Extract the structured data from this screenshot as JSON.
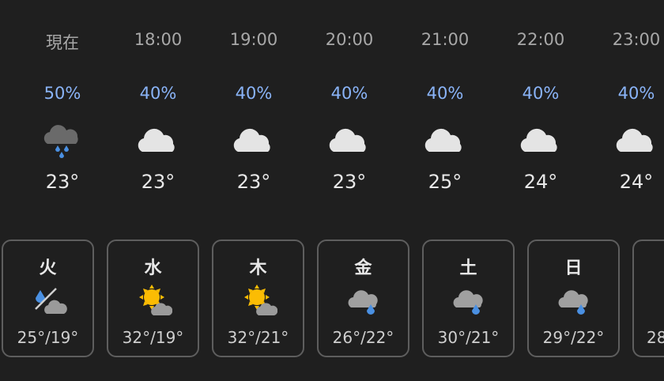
{
  "hourly": [
    {
      "time": "現在",
      "precip": "50%",
      "temp": "23°",
      "icon": "cloud-rain-icon"
    },
    {
      "time": "18:00",
      "precip": "40%",
      "temp": "23°",
      "icon": "cloud-icon"
    },
    {
      "time": "19:00",
      "precip": "40%",
      "temp": "23°",
      "icon": "cloud-icon"
    },
    {
      "time": "20:00",
      "precip": "40%",
      "temp": "23°",
      "icon": "cloud-icon"
    },
    {
      "time": "21:00",
      "precip": "40%",
      "temp": "25°",
      "icon": "cloud-icon"
    },
    {
      "time": "22:00",
      "precip": "40%",
      "temp": "24°",
      "icon": "cloud-icon"
    },
    {
      "time": "23:00",
      "precip": "40%",
      "temp": "24°",
      "icon": "cloud-icon"
    }
  ],
  "daily": [
    {
      "day": "火",
      "temps": "25°/19°",
      "icon": "rain-or-cloudy-icon"
    },
    {
      "day": "水",
      "temps": "32°/19°",
      "icon": "sun-cloud-icon"
    },
    {
      "day": "木",
      "temps": "32°/21°",
      "icon": "sun-cloud-icon"
    },
    {
      "day": "金",
      "temps": "26°/22°",
      "icon": "cloud-rain-icon"
    },
    {
      "day": "土",
      "temps": "30°/21°",
      "icon": "cloud-rain-icon"
    },
    {
      "day": "日",
      "temps": "29°/22°",
      "icon": "cloud-rain-icon"
    },
    {
      "day": "",
      "temps": "28",
      "icon": ""
    }
  ],
  "colors": {
    "background": "#1f1f1f",
    "precip_text": "#8ab4f8",
    "sun": "#fbbc04",
    "rain_drop": "#4a90e2",
    "card_border": "#5e5e5e"
  }
}
